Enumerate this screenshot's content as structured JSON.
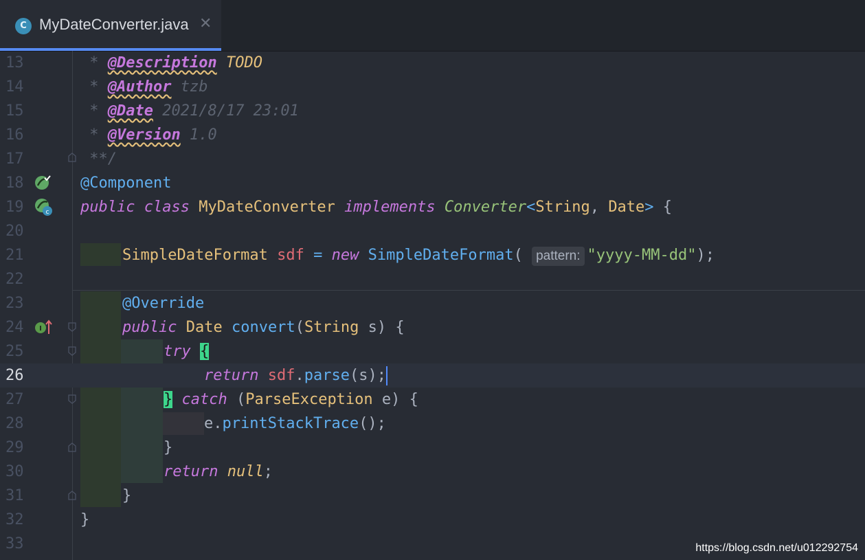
{
  "tab": {
    "icon_letter": "C",
    "title": "MyDateConverter.java",
    "close": "✕"
  },
  "editor": {
    "current_line": "26",
    "lines": [
      {
        "num": "13"
      },
      {
        "num": "14"
      },
      {
        "num": "15"
      },
      {
        "num": "16"
      },
      {
        "num": "17"
      },
      {
        "num": "18"
      },
      {
        "num": "19"
      },
      {
        "num": "20"
      },
      {
        "num": "21"
      },
      {
        "num": "22"
      },
      {
        "num": "23"
      },
      {
        "num": "24"
      },
      {
        "num": "25"
      },
      {
        "num": "26"
      },
      {
        "num": "27"
      },
      {
        "num": "28"
      },
      {
        "num": "29"
      },
      {
        "num": "30"
      },
      {
        "num": "31"
      },
      {
        "num": "32"
      },
      {
        "num": "33"
      }
    ],
    "code": {
      "l13_star": " * ",
      "l13_tag": "@Description",
      "l13_text": "TODO",
      "l14_star": " * ",
      "l14_tag": "@Author",
      "l14_text": "tzb",
      "l15_star": " * ",
      "l15_tag": "@Date",
      "l15_text": "2021/8/17 23:01",
      "l16_star": " * ",
      "l16_tag": "@Version",
      "l16_text": "1.0",
      "l17": " **/",
      "l18": "@Component",
      "l19_public": "public",
      "l19_class": "class",
      "l19_name": "MyDateConverter",
      "l19_implements": "implements",
      "l19_iface": "Converter",
      "l19_lt": "<",
      "l19_t1": "String",
      "l19_comma": ", ",
      "l19_t2": "Date",
      "l19_gt": ">",
      "l19_brace": " {",
      "l21_type": "SimpleDateFormat",
      "l21_var": "sdf",
      "l21_eq": " = ",
      "l21_new": "new",
      "l21_ctor": "SimpleDateFormat",
      "l21_paren": "(",
      "l21_hint": "pattern:",
      "l21_str": "\"yyyy-MM-dd\"",
      "l21_end": ");",
      "l23": "@Override",
      "l24_public": "public",
      "l24_ret": "Date",
      "l24_fn": "convert",
      "l24_open": "(",
      "l24_ptype": "String",
      "l24_rest": " s) {",
      "l25_try": "try",
      "l25_brace": "{",
      "l26_return": "return",
      "l26_var": "sdf",
      "l26_dot": ".",
      "l26_fn": "parse",
      "l26_rest": "(s);",
      "l27_brace": "}",
      "l27_catch": "catch",
      "l27_open": " (",
      "l27_type": "ParseException",
      "l27_rest": " e) {",
      "l28_var": "e.",
      "l28_fn": "printStackTrace",
      "l28_rest": "();",
      "l29": "}",
      "l30_return": "return",
      "l30_null": "null",
      "l30_semi": ";",
      "l31": "}",
      "l32": "}"
    }
  },
  "watermark": "https://blog.csdn.net/u012292754",
  "colors": {
    "background": "#282c34",
    "keyword": "#c678dd",
    "annotation": "#61afef",
    "type": "#e5c07b",
    "string": "#98c379",
    "field": "#e06c75",
    "accent": "#568af2"
  }
}
